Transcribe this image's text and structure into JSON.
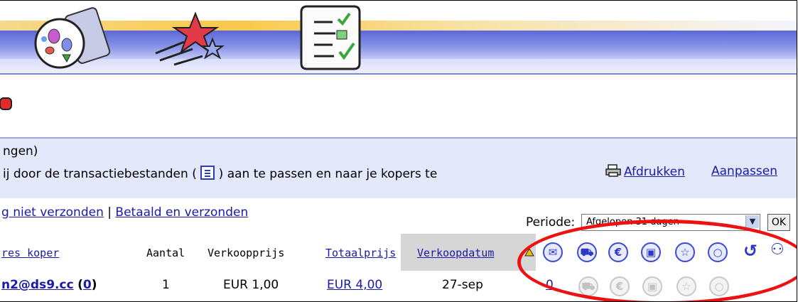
{
  "info": {
    "line1": "ngen)",
    "line2_start": "ij door de transactiebestanden (",
    "line2_end": ") aan te passen en naar je kopers te",
    "print_label": "Afdrukken",
    "adjust_label": "Aanpassen"
  },
  "filters": {
    "link1": "g niet verzonden",
    "separator": "|",
    "link2": "Betaald en verzonden",
    "periode_label": "Periode:",
    "periode_value": "Afgelopen 31 dagen",
    "ok_label": "OK"
  },
  "table": {
    "headers": {
      "buyer": "res koper",
      "quantity": "Aantal",
      "sale_price": "Verkoopprijs",
      "total_price": "Totaalprijs",
      "sale_date": "Verkoopdatum"
    },
    "row": {
      "buyer": "n2@ds9.cc",
      "feedback": "(0)",
      "feedback_value": "0",
      "quantity": "1",
      "sale_price": "EUR 1,00",
      "total_price": "EUR 4,00",
      "sale_date": "27-sep",
      "count": "0"
    }
  },
  "icons": {
    "header": [
      "envelope-icon",
      "cart-icon",
      "euro-icon",
      "box-icon",
      "star-icon",
      "speech-bubble-icon",
      "refresh-icon",
      "people-icon"
    ],
    "row": [
      "cart-icon",
      "euro-icon",
      "box-icon",
      "star-icon",
      "speech-bubble-icon"
    ],
    "glyphs": {
      "envelope": "✉",
      "cart": "⛟",
      "euro": "€",
      "box": "▣",
      "star": "☆",
      "bubble": "○",
      "refresh": "↺",
      "people": "⚇"
    }
  },
  "colors": {
    "link": "#1a1aa6",
    "info_bg": "#e4e8fb",
    "highlight_ellipse": "#ee1111",
    "sorted_column_bg": "#d6d6d6"
  }
}
